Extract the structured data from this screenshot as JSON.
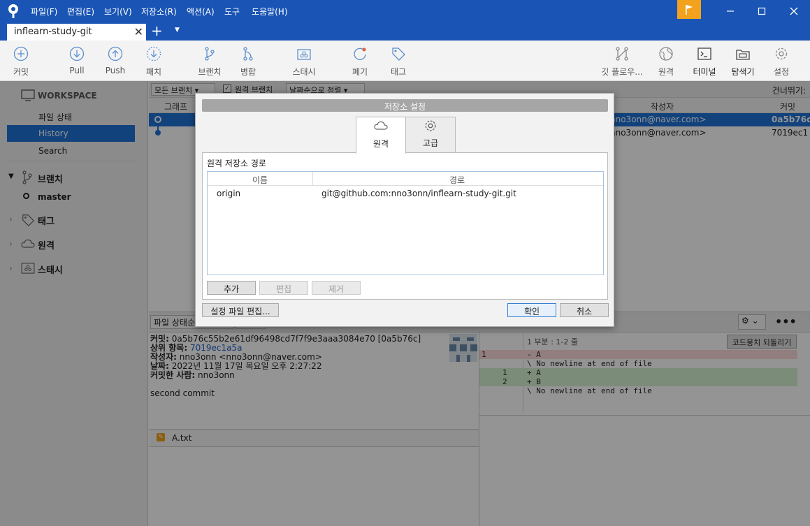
{
  "titlebar": {
    "menus": [
      "파일(F)",
      "편집(E)",
      "보기(V)",
      "저장소(R)",
      "액션(A)",
      "도구",
      "도움말(H)"
    ]
  },
  "tab": {
    "label": "inflearn-study-git"
  },
  "toolbar": {
    "left": [
      {
        "label": "커밋",
        "icon": "plus-circle-icon"
      },
      {
        "label": "Pull",
        "icon": "arrow-down-circle-icon"
      },
      {
        "label": "Push",
        "icon": "arrow-up-circle-icon"
      },
      {
        "label": "패치",
        "icon": "patch-icon"
      },
      {
        "label": "브랜치",
        "icon": "branch-icon"
      },
      {
        "label": "병합",
        "icon": "merge-icon"
      },
      {
        "label": "스태시",
        "icon": "stash-icon"
      },
      {
        "label": "폐기",
        "icon": "discard-icon"
      },
      {
        "label": "태그",
        "icon": "tag-icon"
      }
    ],
    "right": [
      {
        "label": "깃 플로우...",
        "icon": "git-flow-icon"
      },
      {
        "label": "원격",
        "icon": "globe-icon"
      },
      {
        "label": "터미널",
        "icon": "terminal-icon"
      },
      {
        "label": "탐색기",
        "icon": "explorer-icon"
      },
      {
        "label": "설정",
        "icon": "gear-icon"
      }
    ]
  },
  "sidebar": {
    "workspace": "WORKSPACE",
    "file_status": "파일 상태",
    "history": "History",
    "search": "Search",
    "branches": "브랜치",
    "master": "master",
    "tags": "태그",
    "remotes": "원격",
    "stash": "스태시"
  },
  "filterbar": {
    "all_branches": "모든 브랜치",
    "remote_branches": "원격 브랜치",
    "sort": "날짜순으로 정렬",
    "skip": "건너뛰기:"
  },
  "columns": {
    "graph": "그래프",
    "author": "작성자",
    "commit": "커밋"
  },
  "commits": [
    {
      "author": "nno3onn@naver.com>",
      "hash": "0a5b76c"
    },
    {
      "author": "nno3onn@naver.com>",
      "hash": "7019ec1"
    }
  ],
  "bottombar": {
    "file_status_label": "파일 상태순"
  },
  "commit_detail": {
    "commit_label": "커밋:",
    "commit_value": "0a5b76c55b2e61df96498cd7f7f9e3aaa3084e70 [0a5b76c]",
    "parent_label": "상위 항목:",
    "parent_value": "7019ec1a5a",
    "author_label": "작성자:",
    "author_value": "nno3onn <nno3onn@naver.com>",
    "date_label": "날짜:",
    "date_value": "2022년 11월 17일 목요일 오후 2:27:22",
    "committer_label": "커밋한 사람:",
    "committer_value": "nno3onn",
    "message": "second commit"
  },
  "file": {
    "name": "A.txt"
  },
  "diff": {
    "hunk_header": "1 부분 : 1-2 줄",
    "revert_button": "코드뭉치 되돌리기",
    "lines": [
      {
        "old": "1",
        "new": "",
        "text": "- A",
        "type": "del"
      },
      {
        "old": "",
        "new": "",
        "text": "\\ No newline at end of file",
        "type": "meta"
      },
      {
        "old": "",
        "new": "1",
        "text": "+ A",
        "type": "add"
      },
      {
        "old": "",
        "new": "2",
        "text": "+ B",
        "type": "add"
      },
      {
        "old": "",
        "new": "",
        "text": "\\ No newline at end of file",
        "type": "meta"
      }
    ]
  },
  "dialog": {
    "title": "저장소 설정",
    "tab_remote": "원격",
    "tab_advanced": "고급",
    "section_title": "원격 저장소 경로",
    "col_name": "이름",
    "col_path": "경로",
    "remotes": [
      {
        "name": "origin",
        "path": "git@github.com:nno3onn/inflearn-study-git.git"
      }
    ],
    "add": "추가",
    "edit": "편집",
    "remove": "제거",
    "edit_config": "설정 파일 편집...",
    "ok": "확인",
    "cancel": "취소"
  }
}
